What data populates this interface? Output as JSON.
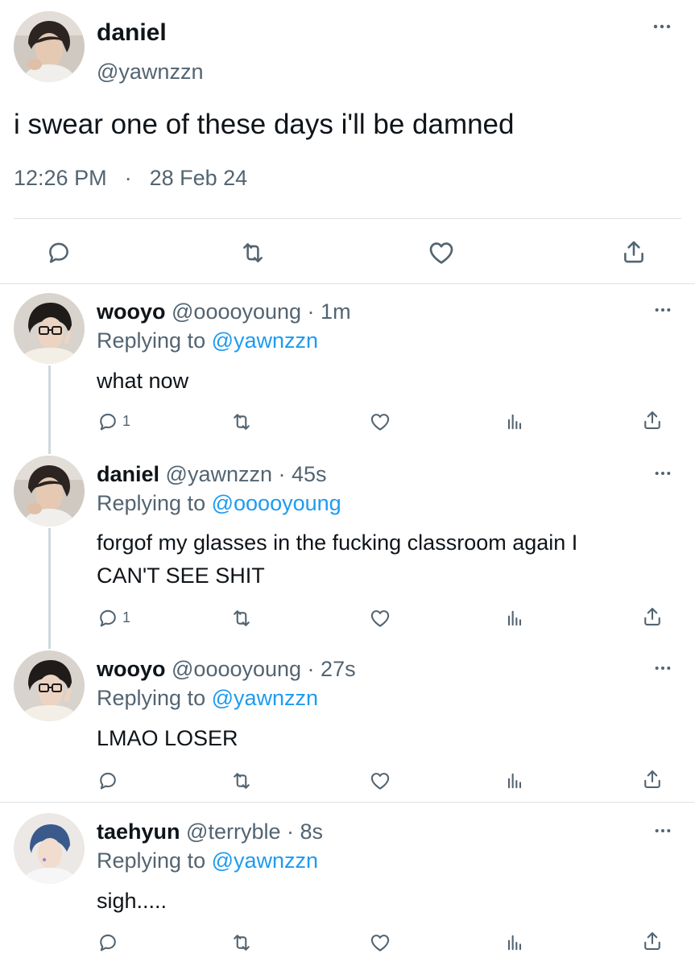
{
  "main_tweet": {
    "name": "daniel",
    "handle": "@yawnzzn",
    "text": "i swear one of these days i'll be damned",
    "time": "12:26 PM",
    "separator": "·",
    "date": "28 Feb 24"
  },
  "replies": [
    {
      "name": "wooyo",
      "handle_time": "@ooooyoung · 1m",
      "replying_prefix": "Replying to",
      "replying_to": "@yawnzzn",
      "text": "what now",
      "reply_count": "1"
    },
    {
      "name": "daniel",
      "handle_time": "@yawnzzn · 45s",
      "replying_prefix": "Replying to",
      "replying_to": "@ooooyoung",
      "text_line1": "forgof my glasses in the fucking classroom again I",
      "text_line2": "CAN'T SEE SHIT",
      "reply_count": "1"
    },
    {
      "name": "wooyo",
      "handle_time": "@ooooyoung · 27s",
      "replying_prefix": "Replying to",
      "replying_to": "@yawnzzn",
      "text": "LMAO LOSER"
    },
    {
      "name": "taehyun",
      "handle_time": "@terryble · 8s",
      "replying_prefix": "Replying to",
      "replying_to": "@yawnzzn",
      "text": "sigh....."
    }
  ],
  "icons": {
    "reply": "reply-icon",
    "retweet": "retweet-icon",
    "like": "heart-icon",
    "views": "views-icon",
    "share": "share-icon",
    "more": "more-icon"
  },
  "colors": {
    "text": "#0f1419",
    "muted": "#536471",
    "link": "#1d9bf0",
    "divider": "#dde3e8"
  }
}
